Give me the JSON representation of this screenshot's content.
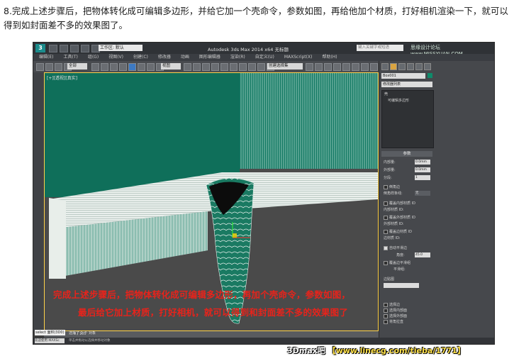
{
  "intro_text": "8.完成上述步骤后，把物体转化成可编辑多边形，并给它加一个壳命令，参数如图，再给他加个材质，打好相机渲染一下，就可以得到如封面差不多的效果图了。",
  "app": {
    "logo": "3",
    "workspace": "工作区: 默认",
    "title": "Autodesk 3ds Max  2014 x64    无标题",
    "search_placeholder": "键入关键字或短语",
    "watermark_top": "思缘设计论坛 www.MISSYUAN.COM"
  },
  "menu": [
    "编辑(E)",
    "工具(T)",
    "组(G)",
    "视图(V)",
    "创建(C)",
    "修改器",
    "动画",
    "图形编辑器",
    "渲染(R)",
    "自定义(U)",
    "MAXScript(X)",
    "帮助(H)"
  ],
  "toolbar": {
    "filter_dropdown": "全部",
    "coord_dropdown": "视图",
    "selection_set_dropdown": "创建选择集"
  },
  "viewport": {
    "label": "[+][透视][真实]"
  },
  "command_panel": {
    "object_name": "Box001",
    "modifier_list": "修改器列表",
    "stack": [
      "壳",
      "可编辑多边形"
    ],
    "params_header": "参数",
    "params": [
      {
        "label": "内部量:",
        "value": "0.0mm"
      },
      {
        "label": "外部量:",
        "value": "0.0mm"
      },
      {
        "label": "分段:",
        "value": "1"
      }
    ],
    "bevel_edges": "倒角边",
    "bevel_spline": "倒角样条线:",
    "bevel_spline_value": "无",
    "override_inner": "覆盖内部材质 ID",
    "inner_mat_id": "内部材质 ID:",
    "override_outer": "覆盖外部材质 ID",
    "outer_mat_id": "外部材质 ID:",
    "override_edge": "覆盖边材质 ID",
    "edge_mat_id": "边材质 ID:",
    "auto_smooth": "自动平滑边",
    "angle_label": "角度:",
    "angle_value": "45.0",
    "override_smooth": "覆盖边平滑组",
    "smooth_group": "平滑组:",
    "edge_mapping": "边贴图",
    "select_edges": "选择边",
    "select_inner": "选择内部面",
    "select_outer": "选择外部面",
    "straighten": "将角拉直"
  },
  "timeline": {
    "frame": "0 / 100"
  },
  "status": {
    "script_line": "select 面积(3D0)",
    "welcome": "欢迎使用 MAXSc",
    "selection_info": "选择了 1 个 对象",
    "hint": "单击并拖动以选择并移动对象"
  },
  "overlay": {
    "line1": "完成上述步骤后，把物体转化成可编辑多边形，再加个壳命令，参数如图，",
    "line2": "最后给它加上材质，打好相机，就可以得到和封面差不多的效果图了"
  },
  "watermark_bottom": {
    "part1": "3Dmax吧",
    "part2": "【www.linecg.com/tieba/1771】"
  },
  "colors": {
    "teal": "#0f8a6a",
    "overlay_red": "#e8231b",
    "viewport_border": "#ffd24a"
  }
}
